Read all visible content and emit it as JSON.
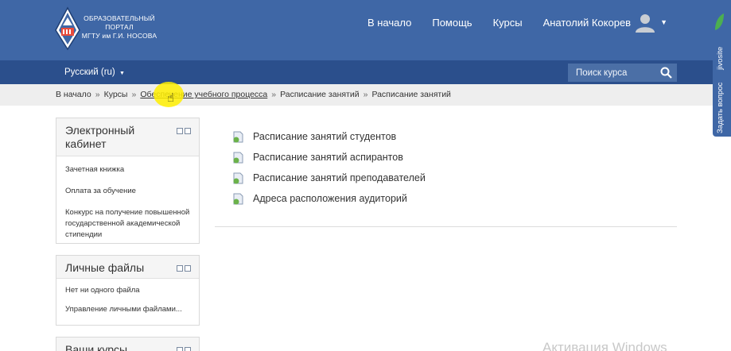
{
  "header": {
    "logo_lines": [
      "ОБРАЗОВАТЕЛЬНЫЙ",
      "ПОРТАЛ",
      "МГТУ им Г.И. НОСОВА"
    ],
    "nav": [
      "В начало",
      "Помощь",
      "Курсы"
    ],
    "user_name": "Анатолий Кокорев"
  },
  "langbar": {
    "language": "Русский (ru)",
    "search_placeholder": "Поиск курса"
  },
  "breadcrumb": [
    "В начало",
    "Курсы",
    "Обеспечение учебного процесса",
    "Расписание занятий",
    "Расписание занятий"
  ],
  "blocks": [
    {
      "title": "Электронный кабинет",
      "items": [
        "Зачетная книжка",
        "Оплата за обучение",
        "Конкурс на получение повышенной государственной академической стипендии"
      ]
    },
    {
      "title": "Личные файлы",
      "items": [
        "Нет ни одного файла",
        "Управление личными файлами..."
      ]
    },
    {
      "title": "Ваши курсы",
      "items": []
    }
  ],
  "main": {
    "links": [
      "Расписание занятий студентов",
      "Расписание занятий аспирантов",
      "Расписание занятий преподавателей",
      "Адреса расположения аудиторий"
    ]
  },
  "side_tab": {
    "label": "Задать вопрос",
    "brand": "jivosite"
  },
  "watermark": "Активация Windows",
  "colors": {
    "header": "#3f67a6",
    "langbar": "#2b4f8c",
    "breadcrumb_bg": "#eeeeee"
  }
}
